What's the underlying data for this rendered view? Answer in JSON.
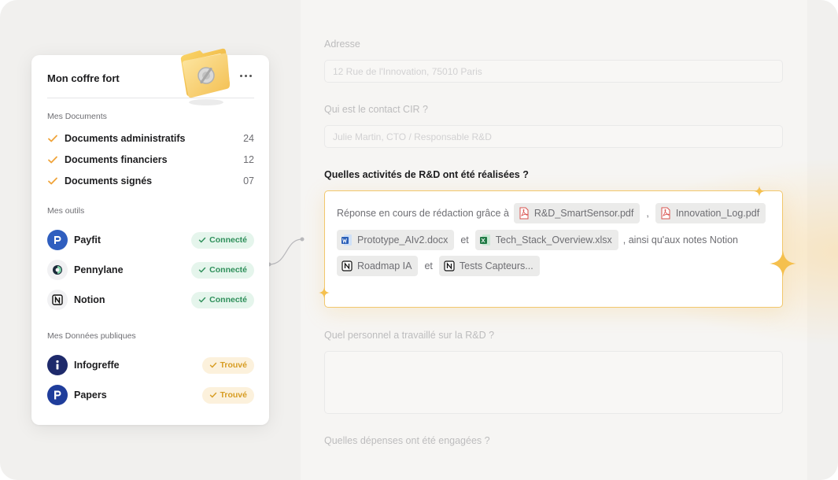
{
  "vault": {
    "title": "Mon coffre fort",
    "documents_section": "Mes Documents",
    "documents": [
      {
        "label": "Documents administratifs",
        "count": "24"
      },
      {
        "label": "Documents financiers",
        "count": "12"
      },
      {
        "label": "Documents signés",
        "count": "07"
      }
    ],
    "tools_section": "Mes outils",
    "tools": [
      {
        "name": "Payfit",
        "status": "Connecté",
        "icon": "payfit-logo-icon"
      },
      {
        "name": "Pennylane",
        "status": "Connecté",
        "icon": "pennylane-logo-icon"
      },
      {
        "name": "Notion",
        "status": "Connecté",
        "icon": "notion-logo-icon"
      }
    ],
    "public_section": "Mes Données publiques",
    "public_sources": [
      {
        "name": "Infogreffe",
        "status": "Trouvé",
        "icon": "infogreffe-logo-icon"
      },
      {
        "name": "Papers",
        "status": "Trouvé",
        "icon": "papers-logo-icon"
      }
    ]
  },
  "form": {
    "address": {
      "label": "Adresse",
      "value": "12 Rue de l'Innovation, 75010 Paris"
    },
    "contact": {
      "label": "Qui est le contact CIR ?",
      "value": "Julie Martin, CTO / Responsable R&D"
    },
    "activities": {
      "label": "Quelles activités de R&D ont été réalisées ?",
      "intro": "Réponse en cours de rédaction grâce à",
      "sep_comma": ",",
      "sep_and": "et",
      "notes_text": ", ainsi qu'aux notes Notion",
      "files": [
        {
          "name": "R&D_SmartSensor.pdf",
          "icon": "pdf-icon"
        },
        {
          "name": "Innovation_Log.pdf",
          "icon": "pdf-icon"
        },
        {
          "name": "Prototype_AIv2.docx",
          "icon": "word-icon"
        },
        {
          "name": "Tech_Stack_Overview.xlsx",
          "icon": "excel-icon"
        },
        {
          "name": "Roadmap IA",
          "icon": "notion-icon"
        },
        {
          "name": "Tests Capteurs...",
          "icon": "notion-icon"
        }
      ]
    },
    "personnel": {
      "label": "Quel personnel a travaillé sur la R&D ?"
    },
    "expenses": {
      "label": "Quelles dépenses ont été engagées ?"
    }
  },
  "colors": {
    "accent_amber": "#f2c76c",
    "connected_green": "#2e8f5a",
    "found_amber": "#d79c22",
    "check_orange": "#f0a43a"
  }
}
